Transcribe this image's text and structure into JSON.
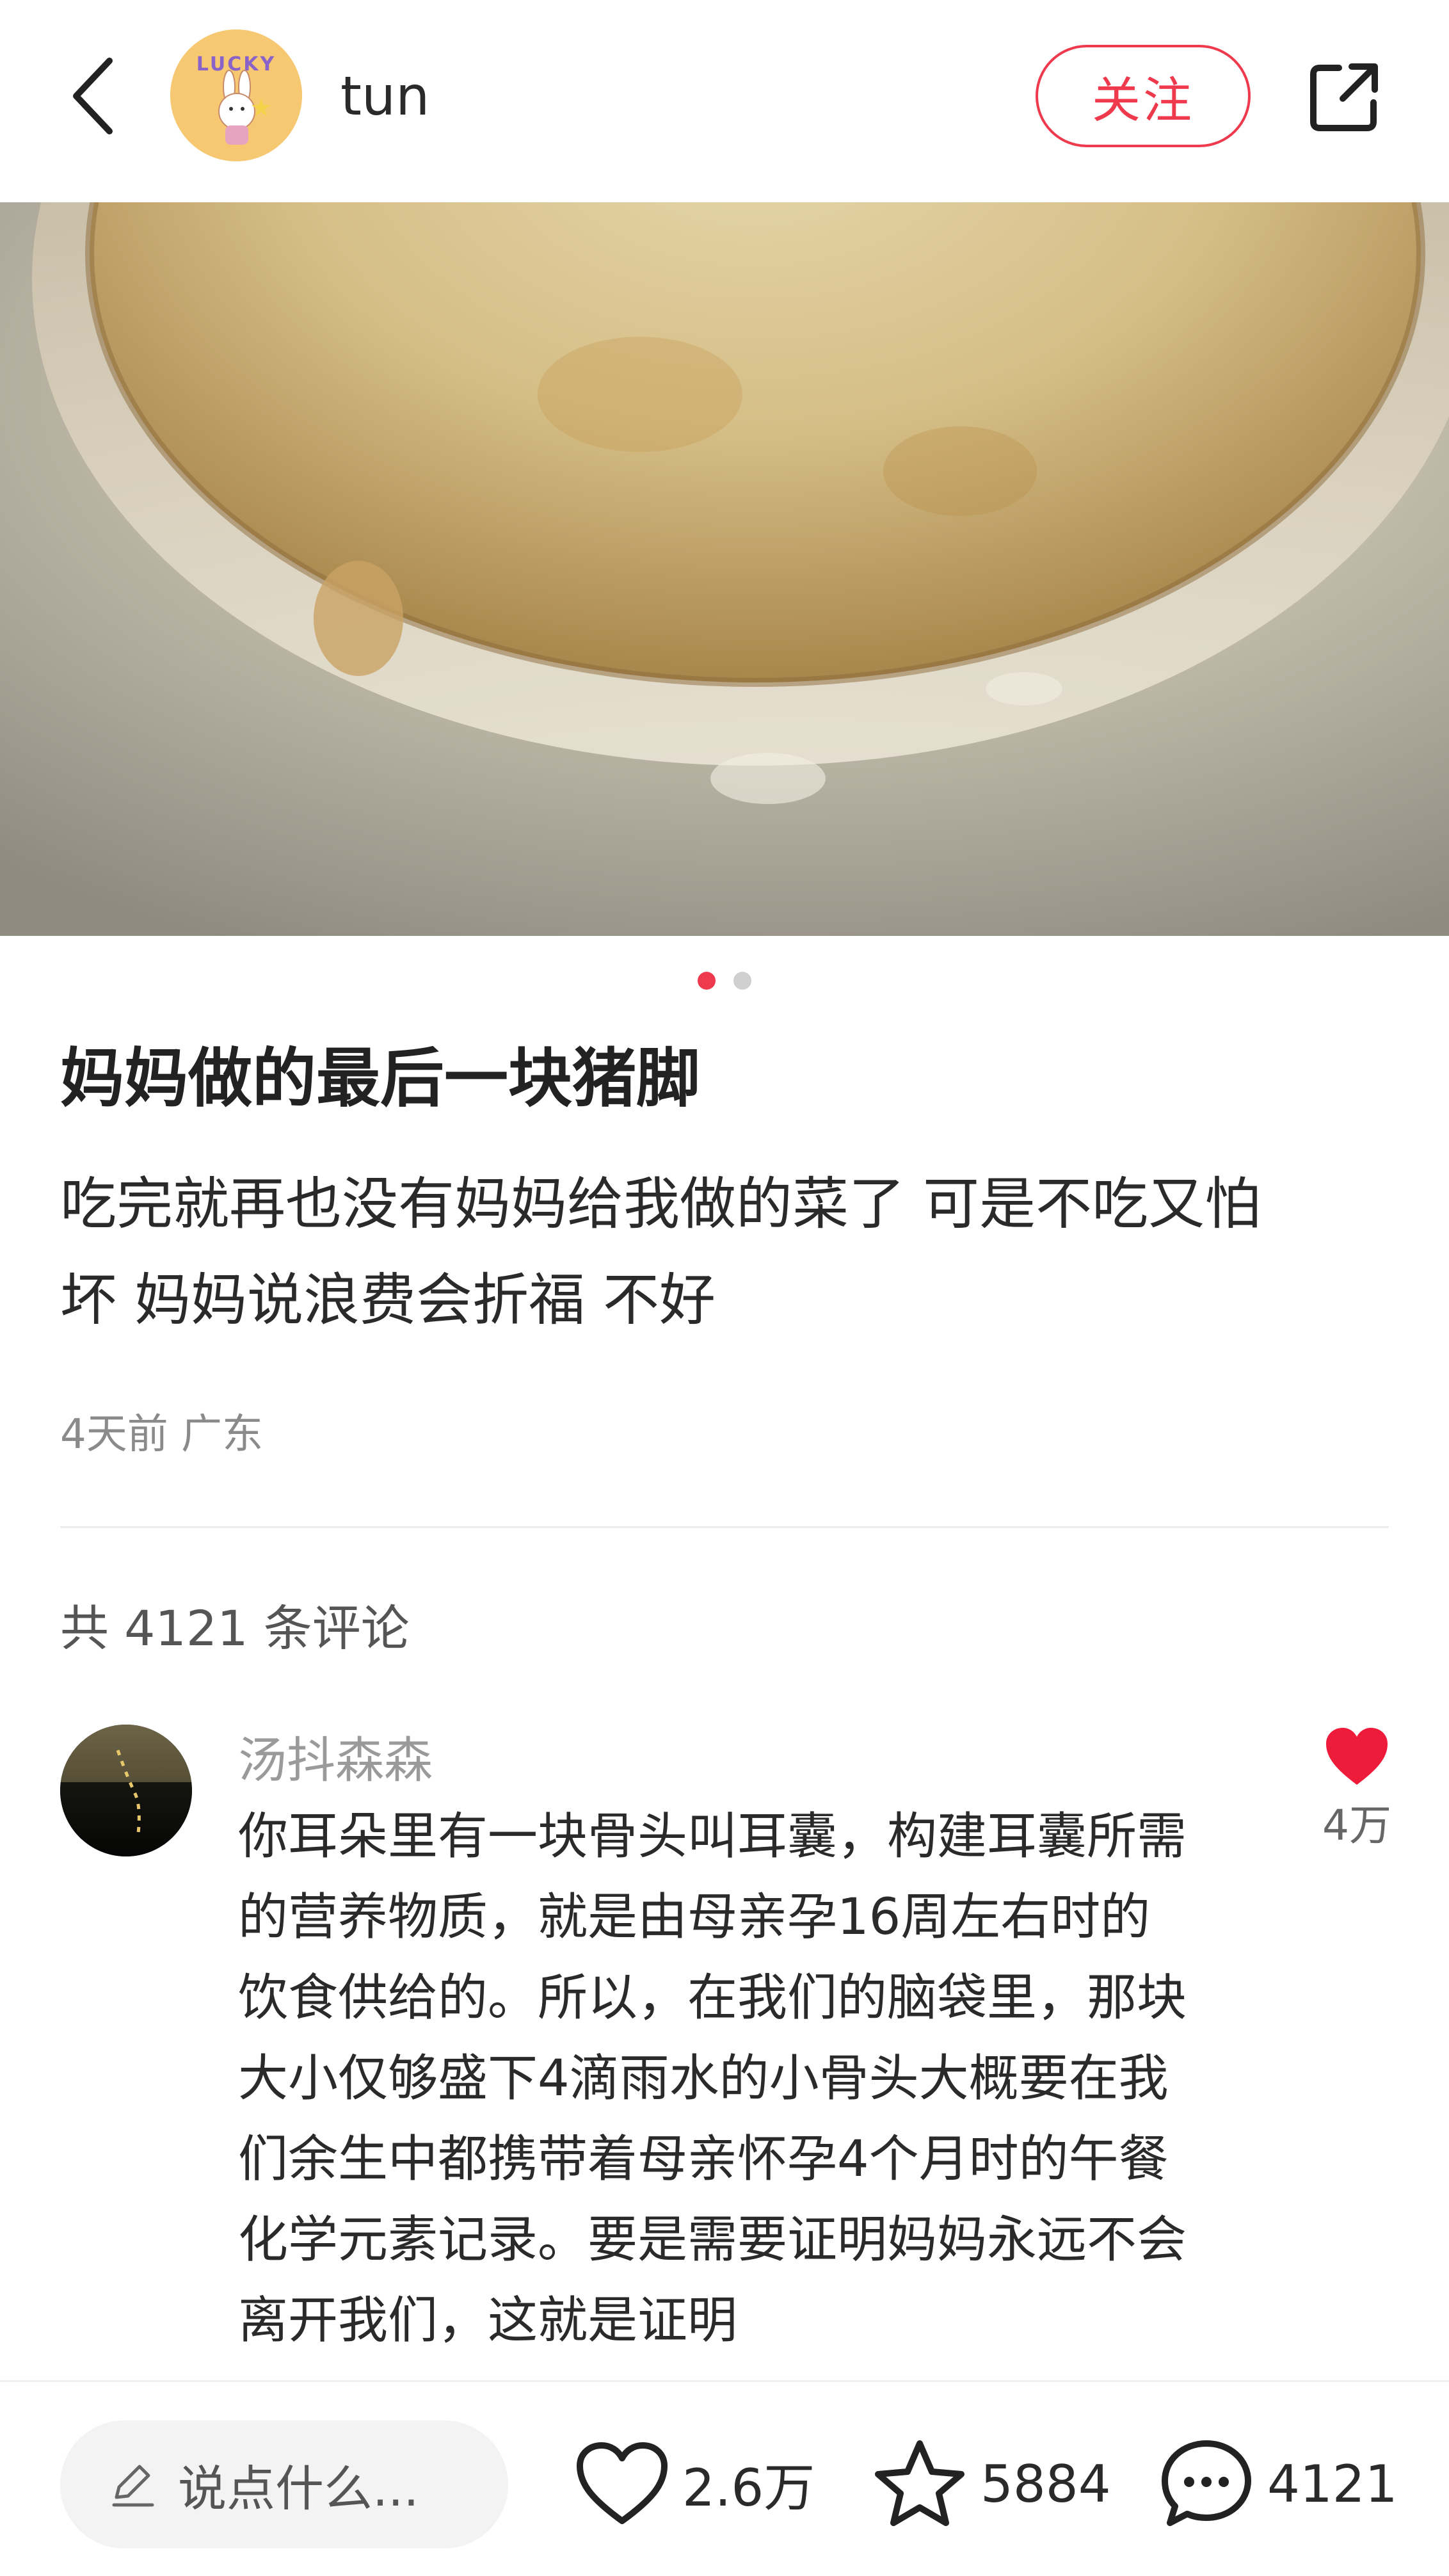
{
  "header": {
    "username": "tun",
    "avatar_label": "LUCKY",
    "follow_label": "关注"
  },
  "post": {
    "title": "妈妈做的最后一块猪脚",
    "body_line1": "吃完就再也没有妈妈给我做的菜了 可是不吃又怕",
    "body_line2": "坏 妈妈说浪费会折福 不好",
    "meta": "4天前 广东",
    "carousel": {
      "total": 2,
      "active": 1
    }
  },
  "comments_section": {
    "count_label": "共 4121 条评论"
  },
  "comment": {
    "author": "汤抖森森",
    "like_count": "4万",
    "lines": [
      "你耳朵里有一块骨头叫耳囊，构建耳囊所需",
      "的营养物质，就是由母亲孕16周左右时的",
      "饮食供给的。所以，在我们的脑袋里，那块",
      "大小仅够盛下4滴雨水的小骨头大概要在我",
      "们余生中都携带着母亲怀孕4个月时的午餐",
      "化学元素记录。要是需要证明妈妈永远不会",
      "离开我们，这就是证明"
    ]
  },
  "bottom_bar": {
    "input_placeholder": "说点什么...",
    "likes": "2.6万",
    "collects": "5884",
    "comments": "4121"
  },
  "colors": {
    "accent": "#ef3a4e",
    "like_heart": "#ee1c3a"
  },
  "icons": [
    "chevron-left-icon",
    "share-icon",
    "heart-icon",
    "star-icon",
    "chat-bubble-icon",
    "pen-icon"
  ]
}
